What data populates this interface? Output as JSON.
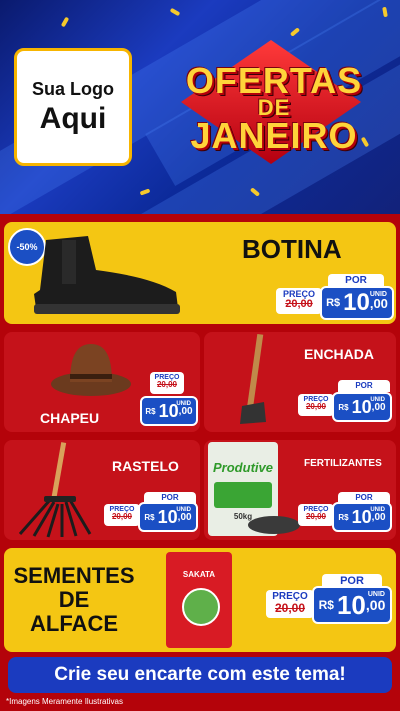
{
  "header": {
    "logo_line1": "Sua Logo",
    "logo_line2": "Aqui",
    "title_line1": "OFERTAS",
    "title_line2": "DE",
    "title_line3": "JANEIRO"
  },
  "colors": {
    "brand_blue": "#1b3bbf",
    "brand_red": "#c5121a",
    "brand_yellow": "#f4c613",
    "title_gold": "#ffd43a"
  },
  "price_labels": {
    "por": "POR",
    "preco": "PREÇO",
    "currency": "R$",
    "unit": "UNID"
  },
  "products": {
    "botina": {
      "name": "BOTINA",
      "discount": "-50%",
      "old_price": "20,00",
      "price_int": "10",
      "price_dec": ",00",
      "icon": "boot-icon"
    },
    "chapeu": {
      "name": "CHAPEU",
      "old_price": "20,00",
      "price_int": "10",
      "price_dec": ",00",
      "icon": "hat-icon"
    },
    "enchada": {
      "name": "ENCHADA",
      "old_price": "20,00",
      "price_int": "10",
      "price_dec": ",00",
      "icon": "hoe-icon"
    },
    "rastelo": {
      "name": "RASTELO",
      "old_price": "20,00",
      "price_int": "10",
      "price_dec": ",00",
      "icon": "rake-icon"
    },
    "fertilizantes": {
      "name": "FERTILIZANTES",
      "bag_brand": "Produtive",
      "bag_weight": "50kg",
      "old_price": "20,00",
      "price_int": "10",
      "price_dec": ",00",
      "icon": "fertilizer-bag-icon"
    },
    "sementes": {
      "name_line1": "SEMENTES",
      "name_line2": "DE",
      "name_line3": "ALFACE",
      "pack_brand": "SAKATA",
      "old_price": "20,00",
      "price_int": "10",
      "price_dec": ",00",
      "icon": "seed-packet-icon"
    }
  },
  "cta": "Crie seu encarte com este tema!",
  "disclaimer": "*Imagens Meramente Ilustrativas"
}
